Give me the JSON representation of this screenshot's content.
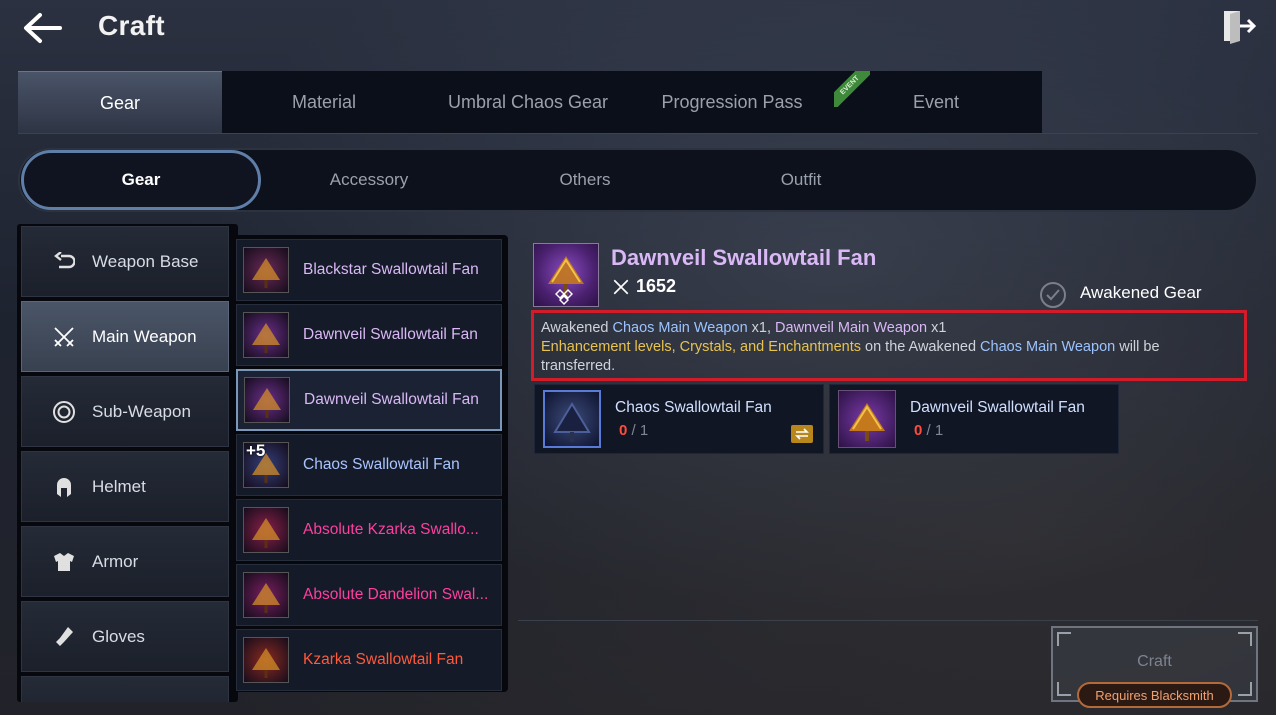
{
  "header": {
    "title": "Craft"
  },
  "top_tabs": [
    {
      "label": "Gear",
      "active": true
    },
    {
      "label": "Material",
      "active": false
    },
    {
      "label": "Umbral Chaos Gear",
      "active": false
    },
    {
      "label": "Progression Pass",
      "active": false
    },
    {
      "label": "Event",
      "active": false,
      "badge": "EVENT"
    }
  ],
  "sub_tabs": [
    {
      "label": "Gear",
      "active": true
    },
    {
      "label": "Accessory",
      "active": false
    },
    {
      "label": "Others",
      "active": false
    },
    {
      "label": "Outfit",
      "active": false
    }
  ],
  "categories": [
    {
      "label": "Weapon Base",
      "icon": "weapon-base-icon",
      "active": false
    },
    {
      "label": "Main Weapon",
      "icon": "crossed-swords-icon",
      "active": true
    },
    {
      "label": "Sub-Weapon",
      "icon": "shield-ring-icon",
      "active": false
    },
    {
      "label": "Helmet",
      "icon": "helmet-icon",
      "active": false
    },
    {
      "label": "Armor",
      "icon": "armor-icon",
      "active": false
    },
    {
      "label": "Gloves",
      "icon": "gloves-icon",
      "active": false
    }
  ],
  "items": [
    {
      "name": "Blackstar Swallowtail Fan",
      "color": "#d9b8f5",
      "thumb": "#6a2a55"
    },
    {
      "name": "Dawnveil Swallowtail Fan",
      "color": "#d9b8f5",
      "thumb": "#6a2f8a"
    },
    {
      "name": "Dawnveil Swallowtail Fan",
      "color": "#d9b8f5",
      "thumb": "#6a2f8a",
      "selected": true
    },
    {
      "name": "Chaos Swallowtail Fan",
      "color": "#a9c4ff",
      "thumb": "#34407a",
      "plus": "+5"
    },
    {
      "name": "Absolute Kzarka Swallo...",
      "color": "#ff3fa0",
      "thumb": "#8a2048"
    },
    {
      "name": "Absolute Dandelion Swal...",
      "color": "#ff3fa0",
      "thumb": "#7a1f60"
    },
    {
      "name": "Kzarka Swallowtail Fan",
      "color": "#ff5a3c",
      "thumb": "#8a2a20"
    }
  ],
  "detail": {
    "title": "Dawnveil Swallowtail Fan",
    "power": "1652",
    "awakened_label": "Awakened Gear",
    "info": {
      "p1": "Awakened ",
      "p2": "Chaos Main Weapon",
      "p3": " x1, ",
      "p4": "Dawnveil Main Weapon",
      "p5": " x1",
      "p6": "Enhancement levels, Crystals, and Enchantments",
      "p7": " on the Awakened ",
      "p8": "Chaos Main Weapon",
      "p9": " will be transferred."
    },
    "materials": [
      {
        "name": "Chaos Swallowtail Fan",
        "have": "0",
        "sep": "/",
        "need": "1",
        "swap": true
      },
      {
        "name": "Dawnveil Swallowtail Fan",
        "have": "0",
        "sep": "/",
        "need": "1",
        "swap": false
      }
    ]
  },
  "craft": {
    "label": "Craft",
    "requirement": "Requires Blacksmith"
  }
}
